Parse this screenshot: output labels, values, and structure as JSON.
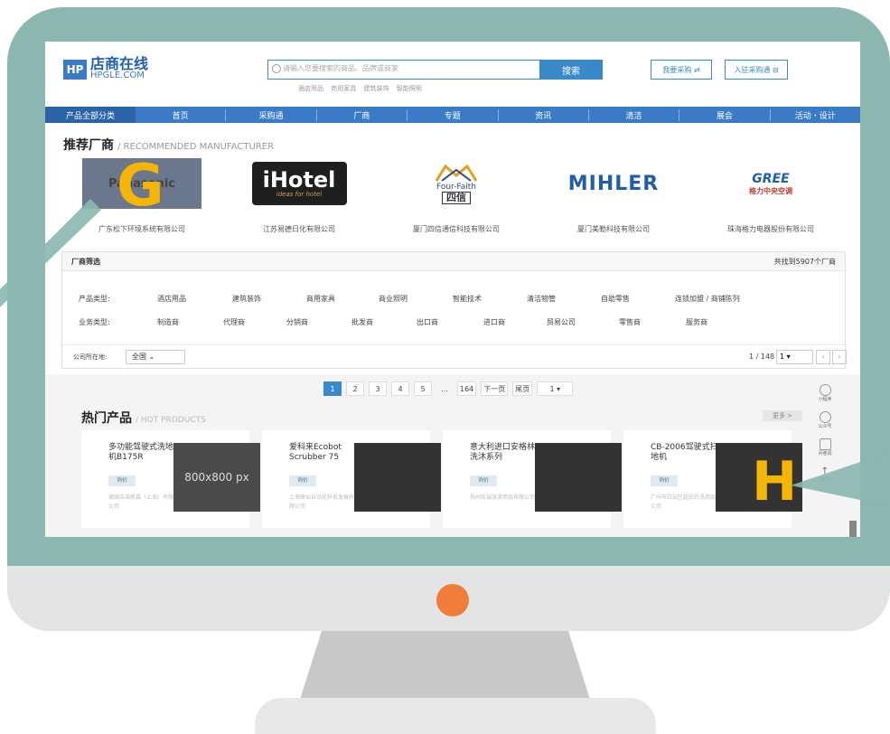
{
  "header": {
    "logo_badge": "HP",
    "logo_cn": "店商在线",
    "logo_en": "HPGLE.COM",
    "search_placeholder": "请输入您要搜索的商品、品牌或商家",
    "search_button": "搜索",
    "hot_keywords": [
      "酒店用品",
      "商用家具",
      "建筑装饰",
      "智能照明"
    ],
    "btn_purchase": "我要采购 ⇄",
    "btn_join": "入驻采购通 ⊟"
  },
  "nav": {
    "all_label": "产品全部分类",
    "items": [
      "首页",
      "采购通",
      "厂商",
      "专题",
      "资讯",
      "清洁",
      "展会",
      "活动・设计"
    ]
  },
  "recommended": {
    "title": "推荐厂商",
    "title_en": "/ RECOMMENDED MANUFACTURER",
    "brands": [
      {
        "logo_text": "Panasonic",
        "overlay": "G",
        "name": "广东松下环境系统有限公司"
      },
      {
        "logo_text": "iHotel",
        "logo_sub": "ideas for hotel",
        "name": "江苏易德日化有限公司"
      },
      {
        "logo_text": "Four-Faith",
        "logo_cn": "四信",
        "name": "厦门四信通信科技有限公司"
      },
      {
        "logo_text": "MIHLER",
        "name": "厦门美勒科技有限公司"
      },
      {
        "logo_text": "GREE",
        "logo_sub": "格力中央空调",
        "name": "珠海格力电器股份有限公司"
      }
    ]
  },
  "filter": {
    "title": "厂商筛选",
    "count": "共找到5907个厂商",
    "product_type_label": "产品类型:",
    "product_types": [
      "酒店用品",
      "建筑装饰",
      "商用家具",
      "商业照明",
      "智能技术",
      "清洁物管",
      "自助零售",
      "连锁加盟 / 商铺陈列"
    ],
    "business_type_label": "业务类型:",
    "business_types": [
      "制造商",
      "代理商",
      "分销商",
      "批发商",
      "出口商",
      "进口商",
      "贸易公司",
      "零售商",
      "服务商"
    ],
    "location_label": "公司所在地:",
    "location_value": "全国",
    "page_info": "1 / 148",
    "page_select": "1"
  },
  "pager": {
    "pages": [
      "1",
      "2",
      "3",
      "4",
      "5",
      "...",
      "164",
      "下一页",
      "尾页"
    ],
    "jump": "1"
  },
  "hot": {
    "title": "热门产品",
    "title_en": "/ HOT PRODUCTS",
    "more": "更多 >",
    "products": [
      {
        "name": "多功能驾驶式洗地机B175R",
        "btn": "询价",
        "company": "德国洁诺新森（上海）有限公司",
        "img_text": "800x800 px"
      },
      {
        "name": "爱科来Ecobot Scrubber 75",
        "btn": "询价",
        "company": "上海高仙自动化科技发展有限公司",
        "img_text": ""
      },
      {
        "name": "意大利进口安格林洗沐系列",
        "btn": "询价",
        "company": "扬州凯瑞旅游用品有限公司",
        "img_text": ""
      },
      {
        "name": "CB-2006驾驶式扫地机",
        "btn": "询价",
        "company": "广州市白云区超宏的洗用品公司",
        "img_text": "",
        "overlay": "H"
      }
    ]
  },
  "tools": [
    "小程序",
    "公众号",
    "问卷调",
    "返回"
  ]
}
